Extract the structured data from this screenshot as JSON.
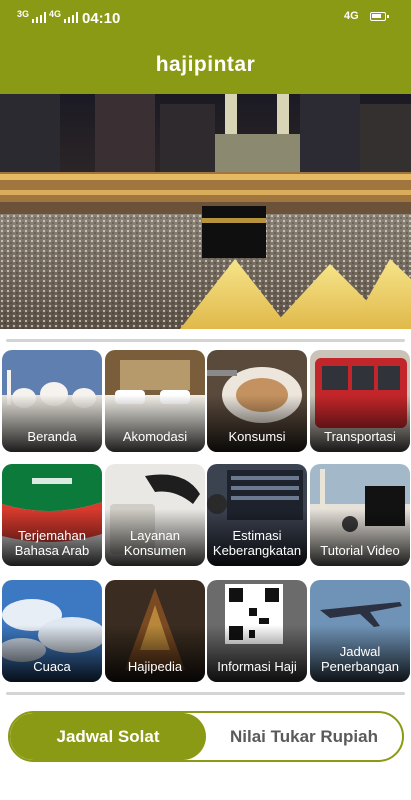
{
  "status_bar": {
    "sim1": "3G",
    "sim2": "4G",
    "time": "04:10",
    "network": "4G"
  },
  "header": {
    "title": "hajipintar"
  },
  "hero": {
    "image": "kaaba-mecca-photo"
  },
  "menu": [
    {
      "label": "Beranda",
      "image": "mosque-domes"
    },
    {
      "label": "Akomodasi",
      "image": "hotel-bed"
    },
    {
      "label": "Konsumsi",
      "image": "food-plate"
    },
    {
      "label": "Transportasi",
      "image": "red-bus"
    },
    {
      "label": "Terjemahan Bahasa Arab",
      "image": "saudi-flag"
    },
    {
      "label": "Layanan Konsumen",
      "image": "telephone"
    },
    {
      "label": "Estimasi Keberangkatan",
      "image": "departure-board"
    },
    {
      "label": "Tutorial Video",
      "image": "kaaba-pilgrims"
    },
    {
      "label": "Cuaca",
      "image": "blue-sky-clouds"
    },
    {
      "label": "Hajipedia",
      "image": "quran-book"
    },
    {
      "label": "Informasi Haji",
      "image": "qr-code-phone"
    },
    {
      "label": "Jadwal Penerbangan",
      "image": "airplane"
    }
  ],
  "tabs": {
    "left": "Jadwal Solat",
    "right": "Nilai Tukar Rupiah"
  },
  "colors": {
    "brand": "#8a9a14"
  }
}
